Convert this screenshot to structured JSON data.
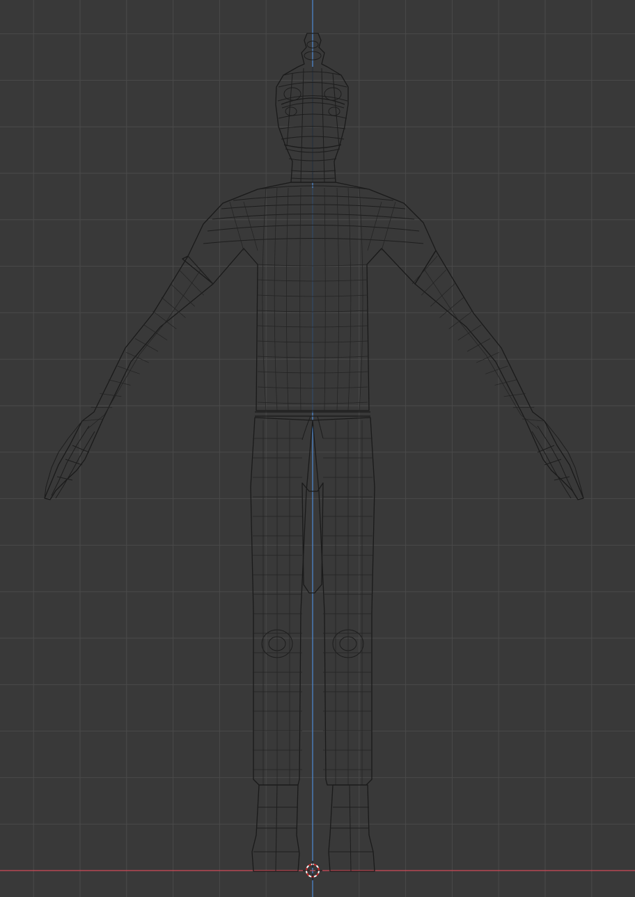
{
  "viewport": {
    "background_color": "#393939",
    "grid_color": "#4a4a4a",
    "x_axis_color": "#d04a57",
    "z_axis_color": "#4e8bd6",
    "wireframe_color": "#1d1d1d",
    "shading": "wireframe",
    "view": "front-orthographic"
  },
  "scene": {
    "object": "humanoid-character-mesh",
    "cursor_icon": "3d-cursor-icon"
  }
}
